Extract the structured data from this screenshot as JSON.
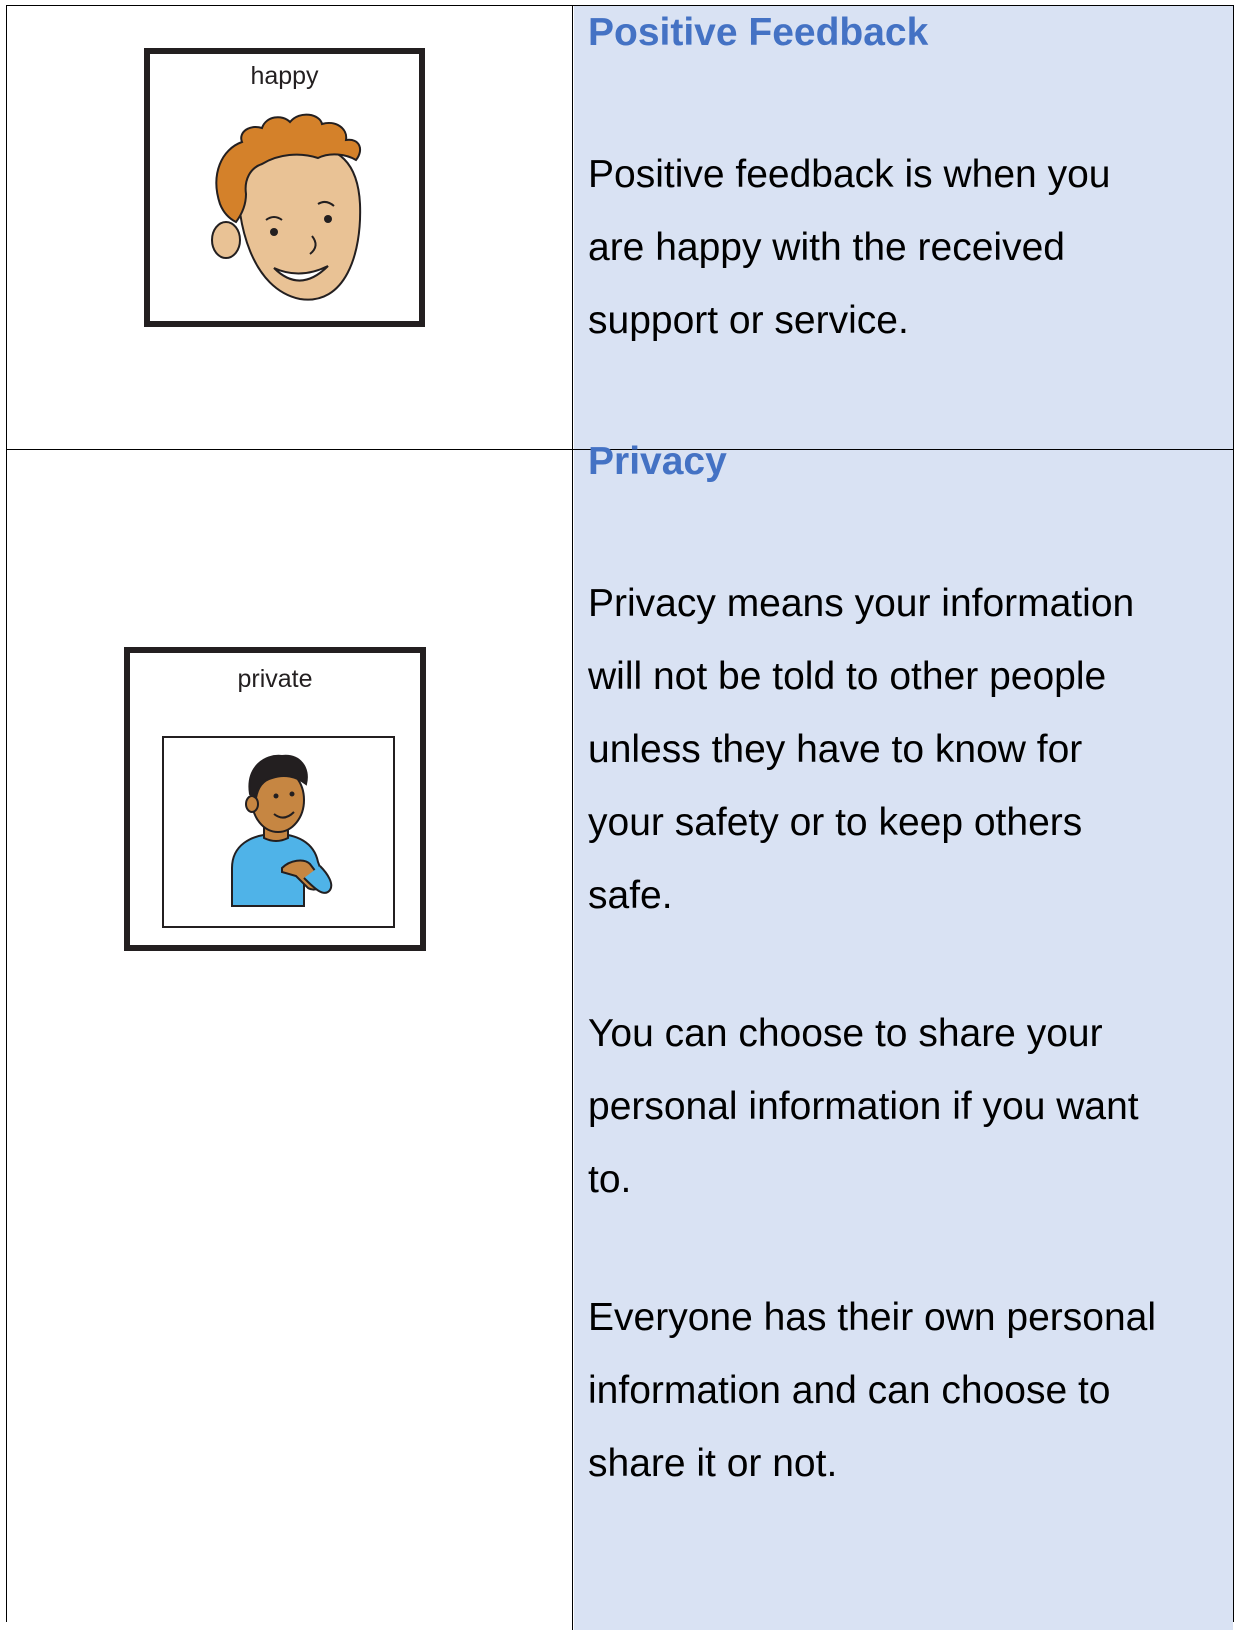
{
  "rows": [
    {
      "symbol": {
        "label": "happy",
        "icon": "happy-face-icon"
      },
      "heading": "Positive Feedback",
      "lines": [
        "Positive feedback is when you",
        "are happy with the received",
        "support or service."
      ]
    },
    {
      "symbol": {
        "label": "private",
        "icon": "private-person-icon"
      },
      "heading": "Privacy",
      "paragraphs": [
        [
          "Privacy means your information",
          "will not be told to other people",
          "unless they have to know for",
          "your safety or to keep others",
          "safe."
        ],
        [
          "You can choose to share your",
          "personal information if you want",
          "to."
        ],
        [
          "Everyone has their own personal",
          "information and can choose to",
          "share it or not."
        ]
      ]
    }
  ],
  "colors": {
    "heading": "#4472c4",
    "cell_shade": "#d9e2f3",
    "border": "#000000",
    "hair": "#d4812a",
    "skin_light": "#e9c295",
    "skin_dark": "#c68642",
    "shirt": "#4fb3e8"
  }
}
